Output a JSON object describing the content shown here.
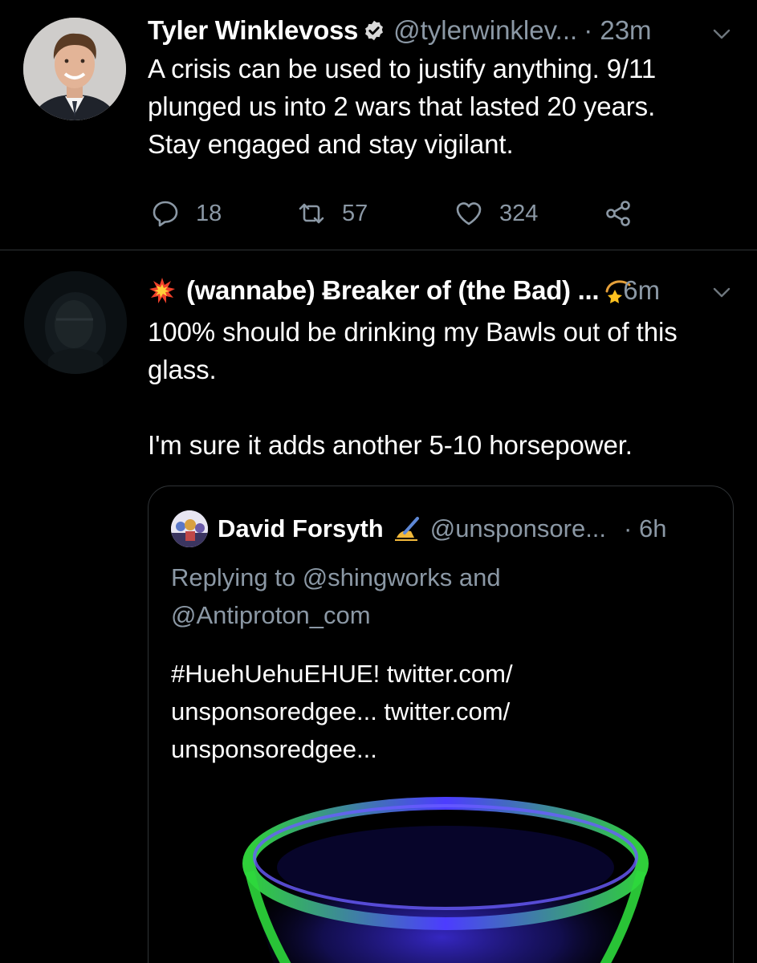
{
  "tweet1": {
    "display_name": "Tyler Winklevoss",
    "handle": "@tylerwinklev...",
    "time": "· 23m",
    "text_lines": [
      "A crisis can be used to justify anything. 9/11",
      "plunged us into 2 wars that lasted 20 years.",
      "Stay engaged and stay vigilant."
    ],
    "replies": "18",
    "retweets": "57",
    "likes": "324"
  },
  "tweet2": {
    "display_name": "(wannabe) Ƀreaker of (the Bad) ...",
    "time": "6m",
    "text_lines": [
      "100% should be drinking my Bawls out of this",
      "glass."
    ],
    "text_line_3": "I'm sure it adds another 5-10 horsepower.",
    "quoted": {
      "display_name": "David Forsyth",
      "handle": "@unsponsore...",
      "time": "· 6h",
      "reply_lines": [
        "Replying to @shingworks and",
        "@Antiproton_com"
      ],
      "text_lines": [
        "#HuehUehuEHUE! twitter.com/",
        "unsponsoredgee... twitter.com/",
        "unsponsoredgee..."
      ]
    }
  },
  "colors": {
    "background": "#000000",
    "secondary_text": "#8b98a5",
    "divider": "#2f3336",
    "glass_green": "#38d640",
    "glass_blue": "#3a3cff"
  }
}
